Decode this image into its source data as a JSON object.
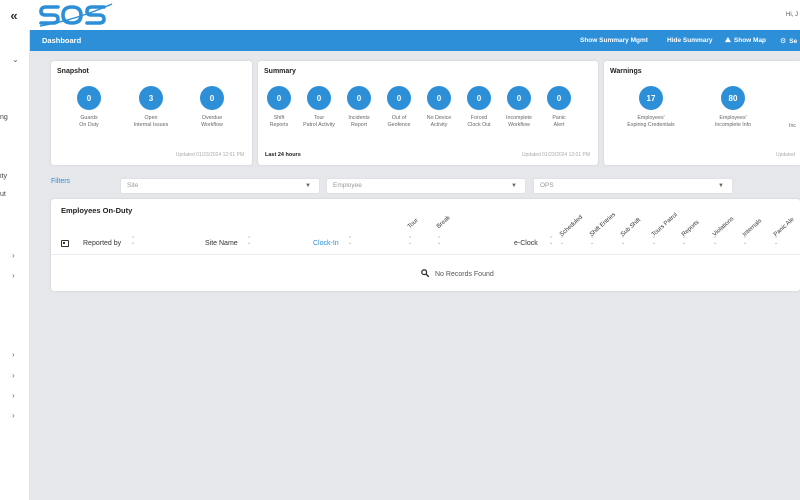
{
  "topbar": {
    "collapse_glyph": "«",
    "logo_text": "SOS",
    "greeting": "Hi, J"
  },
  "sidebar": {
    "fragments": [
      "ng",
      "ity",
      "ut"
    ],
    "chevron_down": "⌄",
    "chevron_right": "›"
  },
  "dashbar": {
    "title": "Dashboard",
    "actions": {
      "summary_mgmt": "Show Summary Mgmt",
      "hide_summary": "Hide Summary",
      "show_map": "Show Map",
      "settings": "Se"
    }
  },
  "snapshot": {
    "title": "Snapshot",
    "stats": [
      {
        "value": "0",
        "label": "Guards\nOn Duty"
      },
      {
        "value": "3",
        "label": "Open\nInternal Issues"
      },
      {
        "value": "0",
        "label": "Overdue\nWorkflow"
      }
    ],
    "updated": "Updated 01/23/2024 12:01 PM"
  },
  "summary": {
    "title": "Summary",
    "stats": [
      {
        "value": "0",
        "label": "Shift\nReports"
      },
      {
        "value": "0",
        "label": "Tour\nPatrol Activity"
      },
      {
        "value": "0",
        "label": "Incidents\nReport"
      },
      {
        "value": "0",
        "label": "Out of\nGeofence"
      },
      {
        "value": "0",
        "label": "No Device\nActivity"
      },
      {
        "value": "0",
        "label": "Forced\nClock Out"
      },
      {
        "value": "0",
        "label": "Incomplete\nWorkflow"
      },
      {
        "value": "0",
        "label": "Panic\nAlert"
      }
    ],
    "period": "Last 24 hours",
    "updated": "Updated 01/23/2024 12:01 PM"
  },
  "warnings": {
    "title": "Warnings",
    "stats": [
      {
        "value": "17",
        "label": "Employees'\nExpiring Credentials"
      },
      {
        "value": "80",
        "label": "Employees'\nIncomplete Info"
      }
    ],
    "partial_label": "Inc",
    "updated": "Updated"
  },
  "filters": {
    "label": "Filters",
    "site_placeholder": "Site",
    "employee_placeholder": "Employee",
    "ops_placeholder": "OPS",
    "caret": "▼"
  },
  "employees": {
    "title": "Employees On-Duty",
    "columns": {
      "reported_by": "Reported by",
      "site_name": "Site Name",
      "clock_in": "Clock-In",
      "eclock": "e-Clock"
    },
    "rotated_columns": [
      "Tour",
      "Break",
      "Scheduled",
      "Shift Entries",
      "Sub Shift",
      "Tours Patrol",
      "Reports",
      "Violations",
      "Internals",
      "Panic Ale"
    ],
    "sort_glyph": "⌃⌄",
    "empty": "No Records Found"
  },
  "colors": {
    "accent": "#2d8fd8",
    "background": "#e6e7ea",
    "card": "#ffffff"
  }
}
